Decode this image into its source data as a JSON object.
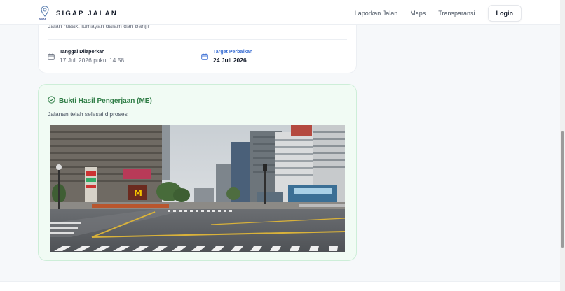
{
  "header": {
    "brand_name": "SIGAP JALAN",
    "logo_caption": "SIGAP",
    "nav": [
      "Laporkan Jalan",
      "Maps",
      "Transparansi"
    ],
    "login_label": "Login"
  },
  "report": {
    "description": "Jalan rusak, lumayan dalam dan banjir",
    "reported_label": "Tanggal Dilaporkan",
    "reported_value": "17 Juli 2026 pukul 14.58",
    "target_label": "Target Perbaikan",
    "target_value": "24 Juli 2026"
  },
  "proof": {
    "title": "Bukti Hasil Pengerjaan (ME)",
    "description": "Jalanan telah selesai diproses",
    "photo_icon": "city-intersection-photo"
  },
  "colors": {
    "accent_green": "#2f7d46",
    "accent_blue": "#3b6fd4",
    "proof_bg": "#f1fbf4"
  }
}
